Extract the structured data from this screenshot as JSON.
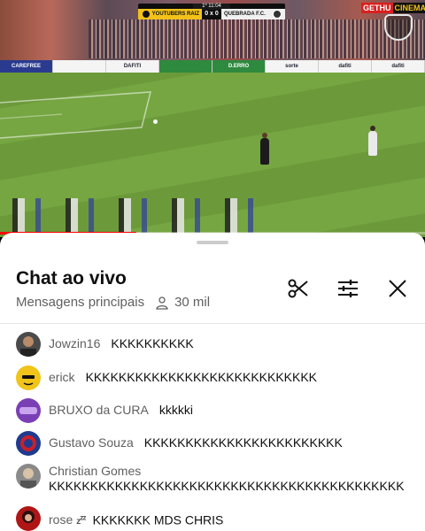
{
  "video": {
    "scoreboard": {
      "team_home": "YOUTUBERS RAIZ",
      "team_away": "QUEBRADA F.C.",
      "score": "0 x 0",
      "clock": "1º 11:04"
    },
    "channel_brand_left": "GETHU",
    "channel_brand_right": "CINEMA",
    "ad_boards": [
      "CAREFREE",
      "",
      "DAFITI",
      "",
      "D.ERRO",
      "sorte",
      "dafiti",
      "dafiti"
    ],
    "progress": 0.32
  },
  "chat": {
    "title": "Chat ao vivo",
    "filter_label": "Mensagens principais",
    "viewer_count": "30 mil",
    "messages": [
      {
        "author": "Jowzin16",
        "text": "KKKKKKKKKK",
        "avatar_color": "#4a4a4a"
      },
      {
        "author": "erick",
        "text": "KKKKKKKKKKKKKKKKKKKKKKKKKKKK",
        "avatar_color": "#f0c419"
      },
      {
        "author": "BRUXO da CURA",
        "text": "kkkkki",
        "avatar_color": "#7b3fb5"
      },
      {
        "author": "Gustavo Souza",
        "text": "KKKKKKKKKKKKKKKKKKKKKKKK",
        "avatar_color": "#1f3b8f"
      },
      {
        "author": "Christian Gomes",
        "text": "KKKKKKKKKKKKKKKKKKKKKKKKKKKKKKKKKKKKKKKKKKK",
        "avatar_color": "#8a8a8a"
      },
      {
        "author": "rose",
        "text": "KKKKKKK MDS CHRIS",
        "avatar_color": "#b01616"
      }
    ]
  }
}
